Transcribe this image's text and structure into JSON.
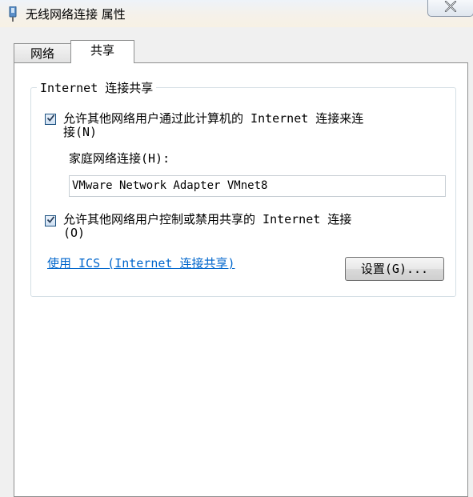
{
  "window": {
    "title": "无线网络连接 属性"
  },
  "tabs": [
    {
      "label": "网络"
    },
    {
      "label": "共享"
    }
  ],
  "sharing": {
    "group_title": "Internet 连接共享",
    "allow_share": {
      "line1": "允许其他网络用户通过此计算机的 Internet 连接来连",
      "line2": "接(N)",
      "checked": true
    },
    "home_network_label": "家庭网络连接(H):",
    "home_network_value": "VMware Network Adapter VMnet8",
    "allow_control": {
      "line1": "允许其他网络用户控制或禁用共享的 Internet 连接",
      "line2": "(O)",
      "checked": true
    },
    "ics_link": "使用 ICS (Internet 连接共享)",
    "settings_button": "设置(G)..."
  },
  "icons": {
    "title": "network-adapter-icon",
    "close": "close-icon",
    "checkbox": "checkmark-icon"
  },
  "colors": {
    "link": "#0066cc",
    "checkbox_border": "#1c5180"
  }
}
